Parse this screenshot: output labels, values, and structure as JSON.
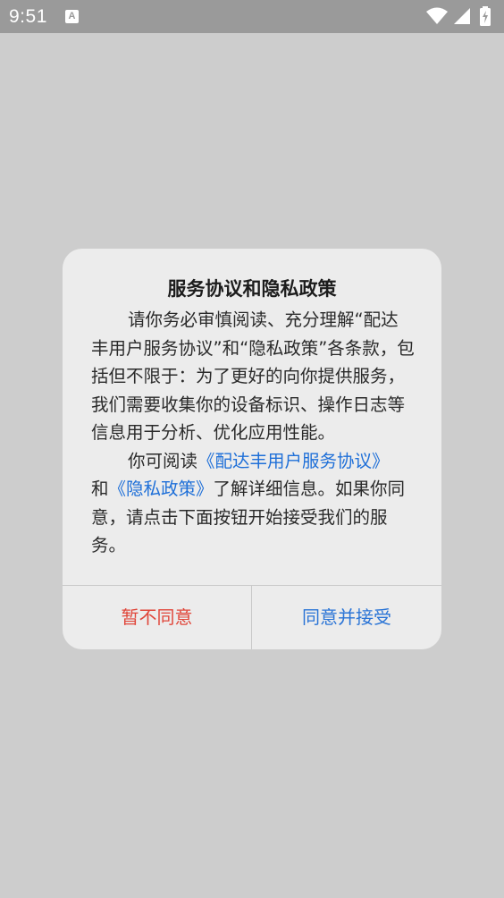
{
  "status_bar": {
    "time": "9:51",
    "notification_icon_letter": "A",
    "icons": [
      "wifi-icon",
      "signal-icon",
      "battery-icon"
    ]
  },
  "dialog": {
    "title": "服务协议和隐私政策",
    "paragraph1": "请你务必审慎阅读、充分理解“配达丰用户服务协议”和“隐私政策”各条款，包括但不限于：为了更好的向你提供服务，我们需要收集你的设备标识、操作日志等信息用于分析、优化应用性能。",
    "paragraph2_prefix": "你可阅读",
    "service_agreement_link": "《配达丰用户服务协议》",
    "paragraph2_and": "和",
    "privacy_policy_link": "《隐私政策》",
    "paragraph2_suffix": "了解详细信息。如果你同意，请点击下面按钮开始接受我们的服务。",
    "disagree_label": "暂不同意",
    "agree_label": "同意并接受"
  },
  "colors": {
    "link": "#1e6fd8",
    "disagree": "#e0463a",
    "agree": "#2a74d6",
    "overlay": "#cdcdcd",
    "dialog_bg": "#ececec"
  }
}
